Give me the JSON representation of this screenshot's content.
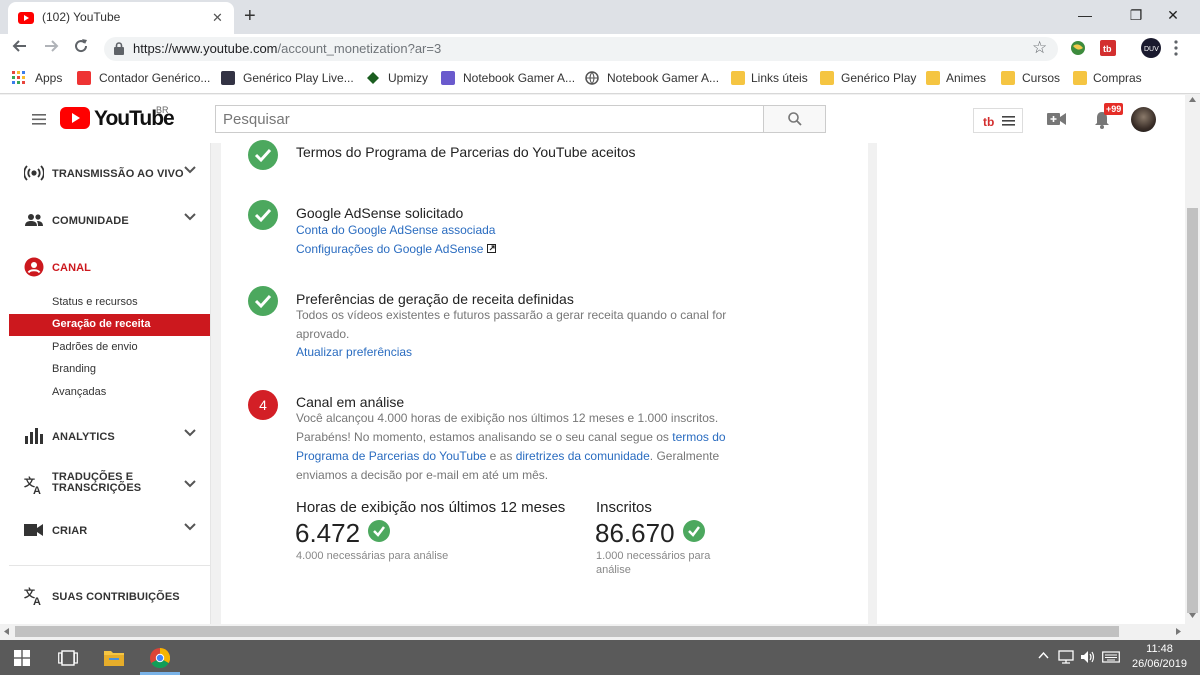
{
  "browser": {
    "tab_title": "(102) YouTube",
    "tab_close": "✕",
    "new_tab": "+",
    "window_controls": {
      "minimize": "—",
      "restore": "❐",
      "close": "✕"
    },
    "url_host": "https://www.youtube.com",
    "url_path": "/account_monetization?ar=3",
    "bookmarks": [
      {
        "label": "Apps",
        "icon": "apps-grid-icon"
      },
      {
        "label": "Contador Genérico...",
        "icon": "red-counter-icon"
      },
      {
        "label": "Genérico Play Live...",
        "icon": "phone-icon"
      },
      {
        "label": "Upmizy",
        "icon": "upmizy-icon"
      },
      {
        "label": "Notebook Gamer A...",
        "icon": "avatar-icon"
      },
      {
        "label": "Notebook Gamer A...",
        "icon": "globe-icon"
      },
      {
        "label": "Links úteis",
        "icon": "folder-icon"
      },
      {
        "label": "Genérico Play",
        "icon": "folder-icon"
      },
      {
        "label": "Animes",
        "icon": "folder-icon"
      },
      {
        "label": "Cursos",
        "icon": "folder-icon"
      },
      {
        "label": "Compras",
        "icon": "folder-icon"
      }
    ]
  },
  "header": {
    "logo_text": "YouTube",
    "country_code": "BR",
    "search_placeholder": "Pesquisar",
    "notification_badge": "+99"
  },
  "sidebar": {
    "sections": [
      {
        "label": "TRANSMISSÃO AO VIVO",
        "icon": "live-icon"
      },
      {
        "label": "COMUNIDADE",
        "icon": "community-icon"
      },
      {
        "label": "CANAL",
        "icon": "channel-icon",
        "active": true
      }
    ],
    "canal_items": [
      {
        "label": "Status e recursos"
      },
      {
        "label": "Geração de receita",
        "active": true
      },
      {
        "label": "Padrões de envio"
      },
      {
        "label": "Branding"
      },
      {
        "label": "Avançadas"
      }
    ],
    "more_sections": [
      {
        "label": "ANALYTICS",
        "icon": "analytics-icon"
      },
      {
        "label_line1": "TRADUÇÕES E",
        "label_line2": "TRANSCRIÇÕES",
        "icon": "translate-icon"
      },
      {
        "label": "CRIAR",
        "icon": "create-icon"
      }
    ],
    "contributions": "SUAS CONTRIBUIÇÕES"
  },
  "main": {
    "step1": {
      "title": "Termos do Programa de Parcerias do YouTube aceitos"
    },
    "step2": {
      "title": "Google AdSense solicitado",
      "link1": "Conta do Google AdSense associada",
      "link2": "Configurações do Google AdSense"
    },
    "step3": {
      "title": "Preferências de geração de receita definidas",
      "desc_line1": "Todos os vídeos existentes e futuros passarão a gerar receita quando o canal for",
      "desc_line2": "aprovado.",
      "link": "Atualizar preferências"
    },
    "step4": {
      "number": "4",
      "title": "Canal em análise",
      "line1": "Você alcançou 4.000 horas de exibição nos últimos 12 meses e 1.000 inscritos.",
      "line2_a": "Parabéns! No momento, estamos analisando se o seu canal segue os ",
      "line2_link": "termos do",
      "line3_link": "Programa de Parcerias do YouTube",
      "line3_b": " e as ",
      "line3_link2": "diretrizes da comunidade",
      "line3_c": ". Geralmente",
      "line4": "enviamos a decisão por e-mail em até um mês."
    },
    "stats": {
      "hours_label": "Horas de exibição nos últimos 12 meses",
      "hours_value": "6.472",
      "hours_note": "4.000 necessárias para análise",
      "subs_label": "Inscritos",
      "subs_value": "86.670",
      "subs_note_line1": "1.000 necessários para",
      "subs_note_line2": "análise"
    }
  },
  "taskbar": {
    "time": "11:48",
    "date": "26/06/2019"
  }
}
